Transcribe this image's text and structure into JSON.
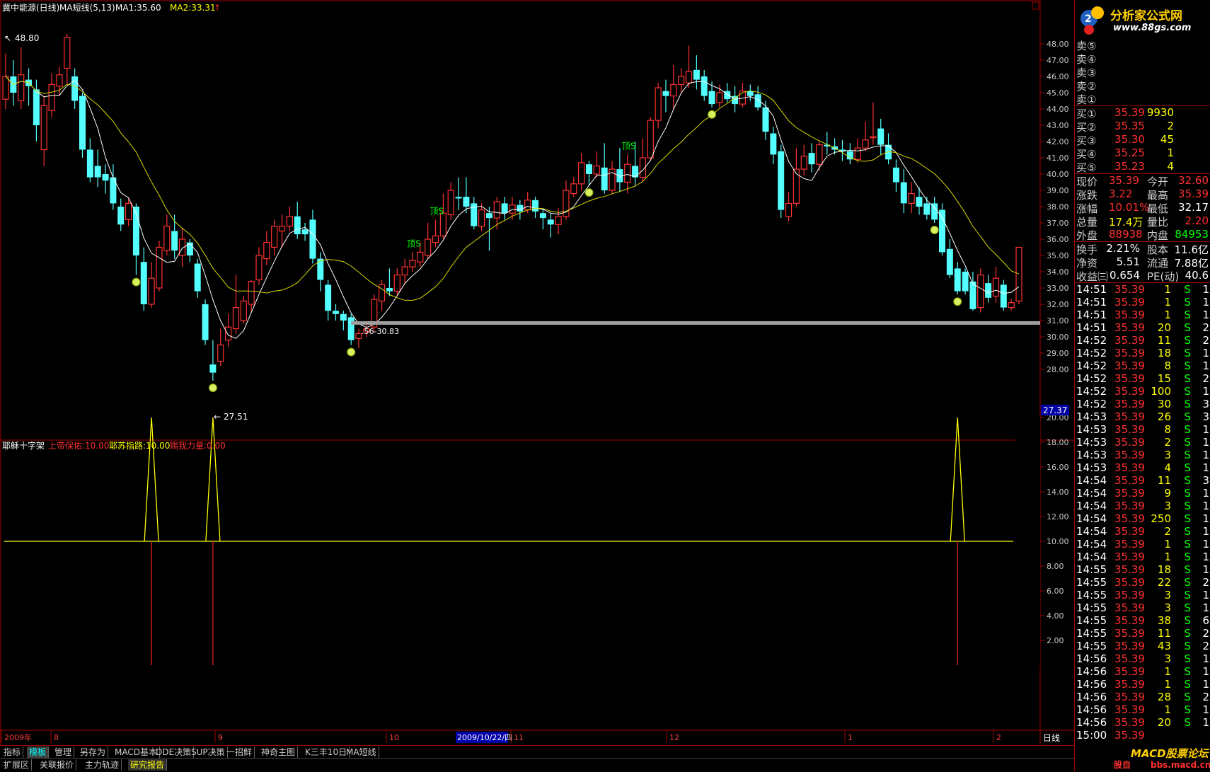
{
  "header": {
    "title": "冀中能源(日线)",
    "ma_name": "MA短线(5,13)",
    "ma1": "MA1:35.60",
    "ma2": "MA2:33.31"
  },
  "indicator_header": {
    "name": "耶稣十字架",
    "p1": "上帝保佑:10.00",
    "p2": "耶苏指路:10.00",
    "p3": "赐我力量:0.00"
  },
  "annotations": {
    "high_label": "48.80",
    "low_label": "27.51",
    "support_label": ".56-30.83",
    "current_price_box": "27.37",
    "buy_marker": "顶S"
  },
  "price_axis": [
    "48.00",
    "47.00",
    "46.00",
    "45.00",
    "44.00",
    "43.00",
    "42.00",
    "41.00",
    "40.00",
    "39.00",
    "38.00",
    "37.00",
    "36.00",
    "35.00",
    "34.00",
    "33.00",
    "32.00",
    "31.00",
    "30.00",
    "29.00",
    "28.00"
  ],
  "indicator_axis": [
    "20.00",
    "18.00",
    "16.00",
    "14.00",
    "12.00",
    "10.00",
    "8.00",
    "6.00",
    "4.00",
    "2.00"
  ],
  "time_axis": {
    "labels": [
      "2009年",
      "8",
      "9",
      "10",
      "2009/10/22/四",
      "11",
      "12",
      "1",
      "2"
    ],
    "period": "日线"
  },
  "chart_data": [
    {
      "type": "candlestick",
      "title": "冀中能源(日线)",
      "ylim": [
        27.0,
        49.0
      ],
      "candles": [
        [
          44.6,
          46.0,
          47.4,
          44.0
        ],
        [
          46.0,
          45.0,
          47.0,
          44.2
        ],
        [
          44.5,
          46.1,
          47.8,
          44.0
        ],
        [
          45.8,
          45.4,
          46.5,
          44.2
        ],
        [
          45.2,
          43.0,
          45.8,
          42.0
        ],
        [
          41.5,
          44.2,
          44.8,
          40.5
        ],
        [
          43.9,
          45.5,
          46.2,
          43.5
        ],
        [
          45.4,
          46.1,
          46.6,
          44.8
        ],
        [
          46.5,
          48.4,
          48.6,
          45.5
        ],
        [
          46.0,
          44.5,
          46.5,
          44.0
        ],
        [
          44.8,
          41.5,
          45.0,
          41.0
        ],
        [
          41.5,
          39.8,
          42.2,
          39.5
        ],
        [
          40.5,
          39.8,
          41.5,
          39.2
        ],
        [
          40.0,
          39.6,
          40.6,
          38.8
        ],
        [
          39.8,
          38.2,
          40.6,
          37.8
        ],
        [
          38.0,
          36.9,
          38.5,
          36.5
        ],
        [
          37.2,
          38.2,
          38.5,
          36.8
        ],
        [
          38.0,
          35.0,
          38.2,
          33.8
        ],
        [
          34.6,
          32.0,
          35.5,
          31.6
        ],
        [
          32.0,
          33.6,
          34.6,
          31.8
        ],
        [
          33.0,
          35.5,
          35.9,
          32.8
        ],
        [
          35.3,
          36.8,
          37.5,
          35.0
        ],
        [
          36.5,
          35.3,
          37.5,
          34.8
        ],
        [
          35.0,
          36.0,
          36.7,
          34.3
        ],
        [
          35.8,
          35.0,
          36.0,
          34.6
        ],
        [
          34.5,
          32.8,
          34.8,
          32.4
        ],
        [
          32.0,
          29.8,
          32.3,
          29.5
        ],
        [
          28.3,
          27.8,
          29.8,
          27.3
        ],
        [
          28.5,
          29.5,
          30.5,
          28.2
        ],
        [
          29.8,
          30.6,
          31.4,
          29.4
        ],
        [
          30.5,
          31.8,
          33.8,
          30.2
        ],
        [
          31.0,
          32.2,
          32.5,
          30.8
        ],
        [
          32.0,
          33.4,
          33.5,
          31.5
        ],
        [
          33.5,
          35.0,
          35.5,
          33.2
        ],
        [
          34.8,
          35.8,
          36.5,
          34.4
        ],
        [
          35.5,
          36.8,
          37.2,
          35.0
        ],
        [
          36.5,
          36.8,
          37.5,
          35.5
        ],
        [
          36.8,
          37.4,
          38.0,
          36.5
        ],
        [
          37.4,
          36.3,
          38.3,
          36.0
        ],
        [
          36.6,
          36.3,
          37.0,
          35.9
        ],
        [
          37.2,
          34.8,
          37.8,
          34.5
        ],
        [
          34.8,
          33.5,
          35.2,
          32.8
        ],
        [
          33.2,
          31.6,
          33.5,
          31.0
        ],
        [
          31.6,
          31.4,
          32.0,
          31.0
        ],
        [
          31.4,
          31.0,
          31.6,
          30.4
        ],
        [
          31.2,
          29.8,
          31.4,
          29.5
        ],
        [
          29.9,
          30.2,
          30.5,
          29.3
        ],
        [
          30.3,
          30.5,
          30.9,
          30.0
        ],
        [
          30.6,
          32.3,
          32.6,
          30.3
        ],
        [
          32.2,
          33.2,
          33.5,
          31.6
        ],
        [
          33.0,
          32.8,
          34.2,
          32.5
        ],
        [
          32.8,
          33.8,
          34.2,
          32.5
        ],
        [
          33.8,
          34.3,
          34.8,
          33.3
        ],
        [
          34.3,
          34.7,
          35.2,
          34.0
        ],
        [
          34.6,
          35.2,
          35.8,
          34.3
        ],
        [
          35.0,
          36.0,
          37.0,
          34.8
        ],
        [
          35.8,
          36.2,
          37.2,
          35.5
        ],
        [
          36.2,
          37.6,
          38.8,
          36.0
        ],
        [
          37.5,
          39.0,
          39.5,
          37.2
        ],
        [
          38.6,
          38.5,
          39.8,
          37.8
        ],
        [
          38.6,
          38.0,
          39.8,
          37.6
        ],
        [
          38.2,
          36.8,
          38.6,
          36.6
        ],
        [
          36.8,
          37.8,
          38.2,
          36.5
        ],
        [
          37.6,
          37.3,
          38.0,
          35.3
        ],
        [
          37.3,
          38.3,
          38.6,
          36.6
        ],
        [
          38.2,
          37.6,
          38.6,
          37.2
        ],
        [
          37.6,
          38.1,
          38.6,
          37.2
        ],
        [
          38.1,
          37.7,
          38.4,
          37.2
        ],
        [
          37.8,
          38.4,
          38.9,
          37.6
        ],
        [
          38.4,
          37.7,
          38.6,
          37.3
        ],
        [
          37.6,
          37.3,
          37.9,
          36.6
        ],
        [
          37.2,
          36.9,
          37.6,
          36.1
        ],
        [
          36.9,
          37.4,
          37.9,
          36.3
        ],
        [
          37.4,
          39.0,
          39.6,
          37.2
        ],
        [
          38.8,
          39.4,
          39.8,
          38.6
        ],
        [
          39.4,
          40.7,
          41.3,
          39.0
        ],
        [
          40.6,
          40.0,
          40.8,
          39.3
        ],
        [
          40.0,
          40.5,
          41.4,
          39.8
        ],
        [
          40.4,
          39.0,
          41.9,
          38.8
        ],
        [
          39.0,
          40.3,
          40.8,
          38.8
        ],
        [
          40.3,
          39.5,
          41.6,
          38.9
        ],
        [
          39.5,
          40.6,
          41.2,
          38.8
        ],
        [
          40.5,
          39.8,
          42.0,
          39.3
        ],
        [
          39.8,
          41.0,
          42.2,
          39.5
        ],
        [
          41.0,
          43.3,
          43.5,
          40.8
        ],
        [
          43.3,
          45.3,
          45.6,
          42.8
        ],
        [
          45.1,
          44.8,
          45.8,
          43.8
        ],
        [
          44.8,
          45.5,
          46.7,
          44.0
        ],
        [
          45.5,
          46.0,
          46.5,
          45.0
        ],
        [
          45.6,
          46.3,
          47.9,
          45.3
        ],
        [
          46.4,
          45.8,
          47.3,
          45.2
        ],
        [
          46.0,
          44.8,
          46.4,
          44.5
        ],
        [
          45.1,
          44.3,
          45.7,
          44.1
        ],
        [
          44.4,
          45.0,
          45.5,
          44.1
        ],
        [
          45.1,
          44.6,
          45.6,
          44.4
        ],
        [
          44.8,
          44.3,
          45.4,
          43.8
        ],
        [
          44.3,
          45.1,
          45.6,
          44.1
        ],
        [
          45.1,
          44.8,
          45.5,
          44.5
        ],
        [
          44.9,
          44.1,
          45.4,
          43.9
        ],
        [
          44.1,
          42.6,
          44.5,
          42.1
        ],
        [
          42.5,
          41.2,
          42.9,
          40.6
        ],
        [
          41.4,
          37.8,
          41.8,
          37.3
        ],
        [
          37.4,
          38.2,
          38.9,
          37.1
        ],
        [
          38.2,
          40.3,
          41.6,
          38.0
        ],
        [
          40.3,
          41.1,
          41.8,
          39.9
        ],
        [
          41.3,
          40.6,
          41.9,
          40.1
        ],
        [
          40.6,
          41.8,
          42.0,
          40.2
        ],
        [
          41.8,
          41.7,
          42.6,
          41.2
        ],
        [
          41.7,
          41.5,
          42.2,
          41.2
        ],
        [
          41.5,
          41.4,
          42.1,
          40.8
        ],
        [
          41.4,
          40.9,
          41.9,
          40.6
        ],
        [
          40.9,
          41.6,
          42.2,
          40.7
        ],
        [
          41.6,
          42.1,
          43.2,
          41.4
        ],
        [
          42.3,
          42.3,
          44.4,
          41.8
        ],
        [
          42.8,
          41.8,
          43.4,
          41.2
        ],
        [
          41.8,
          40.9,
          42.5,
          40.6
        ],
        [
          40.4,
          39.5,
          40.9,
          38.9
        ],
        [
          39.5,
          38.2,
          40.3,
          37.6
        ],
        [
          38.2,
          38.8,
          39.5,
          37.6
        ],
        [
          38.6,
          38.0,
          39.2,
          37.5
        ],
        [
          38.2,
          37.5,
          38.6,
          37.2
        ],
        [
          38.2,
          37.2,
          38.6,
          37.0
        ],
        [
          37.8,
          35.2,
          38.2,
          35.0
        ],
        [
          35.4,
          33.8,
          36.0,
          33.6
        ],
        [
          34.2,
          32.8,
          34.6,
          32.6
        ],
        [
          34.0,
          32.8,
          34.2,
          32.6
        ],
        [
          33.4,
          31.7,
          34.0,
          31.6
        ],
        [
          31.8,
          33.8,
          34.2,
          31.5
        ],
        [
          33.3,
          32.4,
          33.8,
          32.1
        ],
        [
          32.5,
          33.6,
          34.3,
          32.1
        ],
        [
          33.2,
          31.8,
          33.5,
          31.6
        ],
        [
          31.8,
          32.1,
          32.3,
          31.6
        ],
        [
          32.2,
          35.5,
          35.5,
          32.0
        ]
      ],
      "ma_short_name": "MA1",
      "ma_short_last": 35.6,
      "ma_long_name": "MA2",
      "ma_long_last": 33.31,
      "support_level": 30.83,
      "high": 48.8,
      "low": 27.51
    },
    {
      "type": "line",
      "title": "耶稣十字架",
      "ylim": [
        0,
        21
      ],
      "baseline": 10,
      "spikes_yellow": [
        {
          "i": 28,
          "v": 20
        },
        {
          "i": 41,
          "v": 20
        },
        {
          "i": 191,
          "v": 20
        }
      ],
      "spikes_red": [
        {
          "i": 28,
          "v": 0
        },
        {
          "i": 41,
          "v": 0
        },
        {
          "i": 191,
          "v": 0
        }
      ]
    }
  ],
  "quote_panel": {
    "sell": [
      {
        "label": "卖⑤",
        "price": "",
        "vol": ""
      },
      {
        "label": "卖④",
        "price": "",
        "vol": ""
      },
      {
        "label": "卖③",
        "price": "",
        "vol": ""
      },
      {
        "label": "卖②",
        "price": "",
        "vol": ""
      },
      {
        "label": "卖①",
        "price": "",
        "vol": ""
      }
    ],
    "buy": [
      {
        "label": "买①",
        "price": "35.39",
        "vol": "9930"
      },
      {
        "label": "买②",
        "price": "35.35",
        "vol": "2"
      },
      {
        "label": "买③",
        "price": "35.30",
        "vol": "45"
      },
      {
        "label": "买④",
        "price": "35.25",
        "vol": "1"
      },
      {
        "label": "买⑤",
        "price": "35.23",
        "vol": "4"
      }
    ],
    "stats": [
      {
        "k1": "现价",
        "v1": "35.39",
        "k2": "今开",
        "v2": "32.60"
      },
      {
        "k1": "涨跌",
        "v1": "3.22",
        "k2": "最高",
        "v2": "35.39"
      },
      {
        "k1": "涨幅",
        "v1": "10.01%",
        "k2": "最低",
        "v2": "32.17"
      },
      {
        "k1": "总量",
        "v1": "17.4万",
        "k2": "量比",
        "v2": "2.20"
      },
      {
        "k1": "外盘",
        "v1": "88938",
        "k2": "内盘",
        "v2": "84953"
      }
    ],
    "stats2": [
      {
        "k1": "换手",
        "v1": "2.21%",
        "k2": "股本",
        "v2": "11.6亿"
      },
      {
        "k1": "净资",
        "v1": "5.51",
        "k2": "流通",
        "v2": "7.88亿"
      },
      {
        "k1": "收益㈢",
        "v1": "0.654",
        "k2": "PE(动)",
        "v2": "40.6"
      }
    ],
    "ticks": [
      [
        "14:51",
        "35.39",
        "1",
        "S",
        "1"
      ],
      [
        "14:51",
        "35.39",
        "1",
        "S",
        "1"
      ],
      [
        "14:51",
        "35.39",
        "1",
        "S",
        "1"
      ],
      [
        "14:51",
        "35.39",
        "20",
        "S",
        "2"
      ],
      [
        "14:52",
        "35.39",
        "11",
        "S",
        "2"
      ],
      [
        "14:52",
        "35.39",
        "18",
        "S",
        "1"
      ],
      [
        "14:52",
        "35.39",
        "8",
        "S",
        "1"
      ],
      [
        "14:52",
        "35.39",
        "15",
        "S",
        "2"
      ],
      [
        "14:52",
        "35.39",
        "100",
        "S",
        "1"
      ],
      [
        "14:52",
        "35.39",
        "30",
        "S",
        "3"
      ],
      [
        "14:53",
        "35.39",
        "26",
        "S",
        "3"
      ],
      [
        "14:53",
        "35.39",
        "8",
        "S",
        "1"
      ],
      [
        "14:53",
        "35.39",
        "2",
        "S",
        "1"
      ],
      [
        "14:53",
        "35.39",
        "3",
        "S",
        "1"
      ],
      [
        "14:53",
        "35.39",
        "4",
        "S",
        "1"
      ],
      [
        "14:54",
        "35.39",
        "11",
        "S",
        "3"
      ],
      [
        "14:54",
        "35.39",
        "9",
        "S",
        "1"
      ],
      [
        "14:54",
        "35.39",
        "3",
        "S",
        "1"
      ],
      [
        "14:54",
        "35.39",
        "250",
        "S",
        "1"
      ],
      [
        "14:54",
        "35.39",
        "2",
        "S",
        "1"
      ],
      [
        "14:54",
        "35.39",
        "1",
        "S",
        "1"
      ],
      [
        "14:54",
        "35.39",
        "1",
        "S",
        "1"
      ],
      [
        "14:55",
        "35.39",
        "18",
        "S",
        "1"
      ],
      [
        "14:55",
        "35.39",
        "22",
        "S",
        "2"
      ],
      [
        "14:55",
        "35.39",
        "3",
        "S",
        "1"
      ],
      [
        "14:55",
        "35.39",
        "3",
        "S",
        "1"
      ],
      [
        "14:55",
        "35.39",
        "38",
        "S",
        "6"
      ],
      [
        "14:55",
        "35.39",
        "11",
        "S",
        "2"
      ],
      [
        "14:55",
        "35.39",
        "43",
        "S",
        "2"
      ],
      [
        "14:56",
        "35.39",
        "3",
        "S",
        "1"
      ],
      [
        "14:56",
        "35.39",
        "1",
        "S",
        "1"
      ],
      [
        "14:56",
        "35.39",
        "1",
        "S",
        "1"
      ],
      [
        "14:56",
        "35.39",
        "28",
        "S",
        "2"
      ],
      [
        "14:56",
        "35.39",
        "1",
        "S",
        "1"
      ],
      [
        "14:56",
        "35.39",
        "20",
        "S",
        "1"
      ],
      [
        "15:00",
        "35.39",
        "",
        "",
        " "
      ]
    ],
    "footer": "笔"
  },
  "brand": {
    "title": "分析家公式网",
    "url": "www.88gs.com",
    "macd_logo": "MACD股票论坛",
    "macd_sub": "bbs.macd.cn",
    "macd_left": "股自"
  },
  "tabs_row1": [
    "指标",
    "模板",
    "管理",
    "另存为",
    "MACD基本",
    "DDE决策",
    "SUP决策",
    "一招鲜",
    "神奇主图",
    "K三丰10日",
    "MA短线"
  ],
  "tabs_row2": [
    "扩展区",
    "关联报价",
    "主力轨迹",
    "研究报告"
  ],
  "colors": {
    "up": "#ff3232",
    "down": "#54ffff",
    "ma1": "#ffffff",
    "ma2": "#d8d800",
    "grid_red": "#a00000",
    "yellow": "#ffff00",
    "green": "#00ff00"
  }
}
